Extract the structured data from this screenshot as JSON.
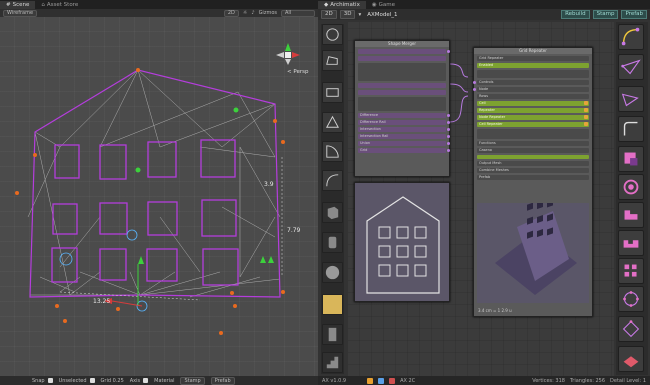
{
  "scene_panel": {
    "tabs": [
      {
        "label": "Scene",
        "icon": "scene-icon"
      },
      {
        "label": "Asset Store",
        "icon": "store-icon"
      }
    ],
    "toolbar": {
      "shading_mode": "Wireframe",
      "mode_2d": "2D",
      "gizmos": "Gizmos",
      "search_placeholder": "All"
    },
    "persp_label": "< Persp",
    "dimensions": {
      "height": "7.79",
      "width": "13.25",
      "depth": "3.9"
    },
    "bottom": {
      "snap": "Snap",
      "unselected": "Unselected",
      "grid_label": "Grid",
      "grid_value": "0.25",
      "axis": "Axis",
      "material": "Material",
      "stamp": "Stamp",
      "prefab": "Prefab"
    }
  },
  "archimatix_panel": {
    "tabs": [
      {
        "label": "Archimatix",
        "icon": "archimatix-icon"
      },
      {
        "label": "Game",
        "icon": "game-icon"
      }
    ],
    "mode_2d": "2D",
    "mode_3d": "3D",
    "model_name": "AXModel_1",
    "buttons": {
      "rebuild": "Rebuild",
      "stamp": "Stamp",
      "prefab": "Prefab"
    },
    "shape_node": {
      "title": "Shape Merger",
      "rows": [
        "",
        "",
        "",
        "",
        "",
        "",
        "",
        "Difference",
        "Difference Rail",
        "Intersection",
        "Intersection Rail",
        "Union",
        "Grid",
        "Output"
      ]
    },
    "grid_node": {
      "title": "Grid Repeater",
      "rows": [
        "Grid Repeater",
        "Enabled",
        "Controls",
        "Node",
        "Rows",
        "Cell",
        "Repeater",
        "Node Repeater",
        "Cell Repeater",
        "Corner Repeater",
        "Functions",
        "Caseno",
        "Output Mesh",
        "Combine Meshes",
        "Prefab"
      ],
      "footer": "3.4 cm = 1  2.9 u"
    },
    "status": {
      "left": "AX v1.0.9",
      "mid": "AX 2C",
      "vertices_label": "Vertices: ",
      "vertices": "318",
      "triangles_label": "Triangles: ",
      "triangles": "256",
      "detail_label": "Detail Level:",
      "detail": "1"
    }
  },
  "colors": {
    "magenta": "#b43ddc",
    "node_green": "#7da230",
    "accent_teal": "#4d7b77",
    "gizmo_orange": "#e86a1f"
  }
}
